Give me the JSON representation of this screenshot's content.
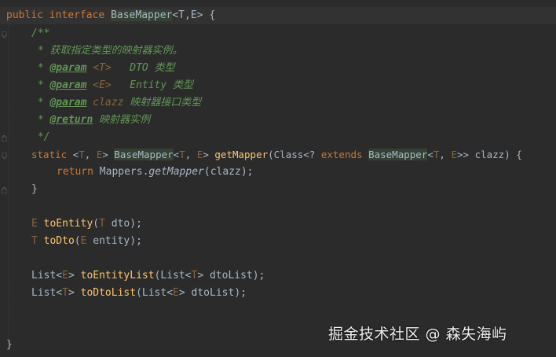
{
  "colors": {
    "background": "#2b2b2b",
    "keyword": "#cc7832",
    "doc_comment": "#629755",
    "type_param": "#8a653b",
    "method": "#ffc66d",
    "default_text": "#a9b7c6"
  },
  "code": {
    "l1": {
      "public": "public",
      "interface": "interface",
      "name": "BaseMapper",
      "generics": "<T,E>",
      "brace": " {"
    },
    "l2": {
      "open": "/**"
    },
    "l3": {
      "text": " * 获取指定类型的映射器实例。"
    },
    "l4": {
      "star": " * ",
      "tag": "@param",
      "p": " <T>",
      "desc": "   DTO 类型"
    },
    "l5": {
      "star": " * ",
      "tag": "@param",
      "p": " <E>",
      "desc": "   Entity 类型"
    },
    "l6": {
      "star": " * ",
      "tag": "@param",
      "p": " clazz",
      "desc": " 映射器接口类型"
    },
    "l7": {
      "star": " * ",
      "tag": "@return",
      "desc": " 映射器实例"
    },
    "l8": {
      "close": " */"
    },
    "l9": {
      "static": "static",
      "gen_open": " <",
      "t1": "T",
      "comma1": ", ",
      "e1": "E",
      "gen_close": "> ",
      "ret_cls": "BaseMapper",
      "rlt": "<",
      "t2": "T",
      "comma2": ", ",
      "e2": "E",
      "rgt": "> ",
      "method": "getMapper",
      "paren": "(Class<? ",
      "extends": "extends",
      "sp": " ",
      "arg_cls": "BaseMapper",
      "alt": "<",
      "t3": "T",
      "comma3": ", ",
      "e3": "E",
      "tail": ">> clazz) {"
    },
    "l10": {
      "return": "return",
      "call1": " Mappers.",
      "call_m": "getMapper",
      "call2": "(clazz);"
    },
    "l11": {
      "close": "}"
    },
    "l12": {
      "t": "E",
      "sp": " ",
      "m": "toEntity",
      "open": "(",
      "pt": "T",
      "rest": " dto);"
    },
    "l13": {
      "t": "T",
      "sp": " ",
      "m": "toDto",
      "open": "(",
      "pt": "E",
      "rest": " entity);"
    },
    "l14": {
      "list": "List<",
      "t": "E",
      "gt": "> ",
      "m": "toEntityList",
      "open": "(List<",
      "pt": "T",
      "rest": "> dtoList);"
    },
    "l15": {
      "list": "List<",
      "t": "T",
      "gt": "> ",
      "m": "toDtoList",
      "open": "(List<",
      "pt": "E",
      "rest": "> dtoList);"
    },
    "l16": {
      "close": "}"
    }
  },
  "watermark": {
    "text": "掘金技术社区 @ 森失海屿"
  }
}
